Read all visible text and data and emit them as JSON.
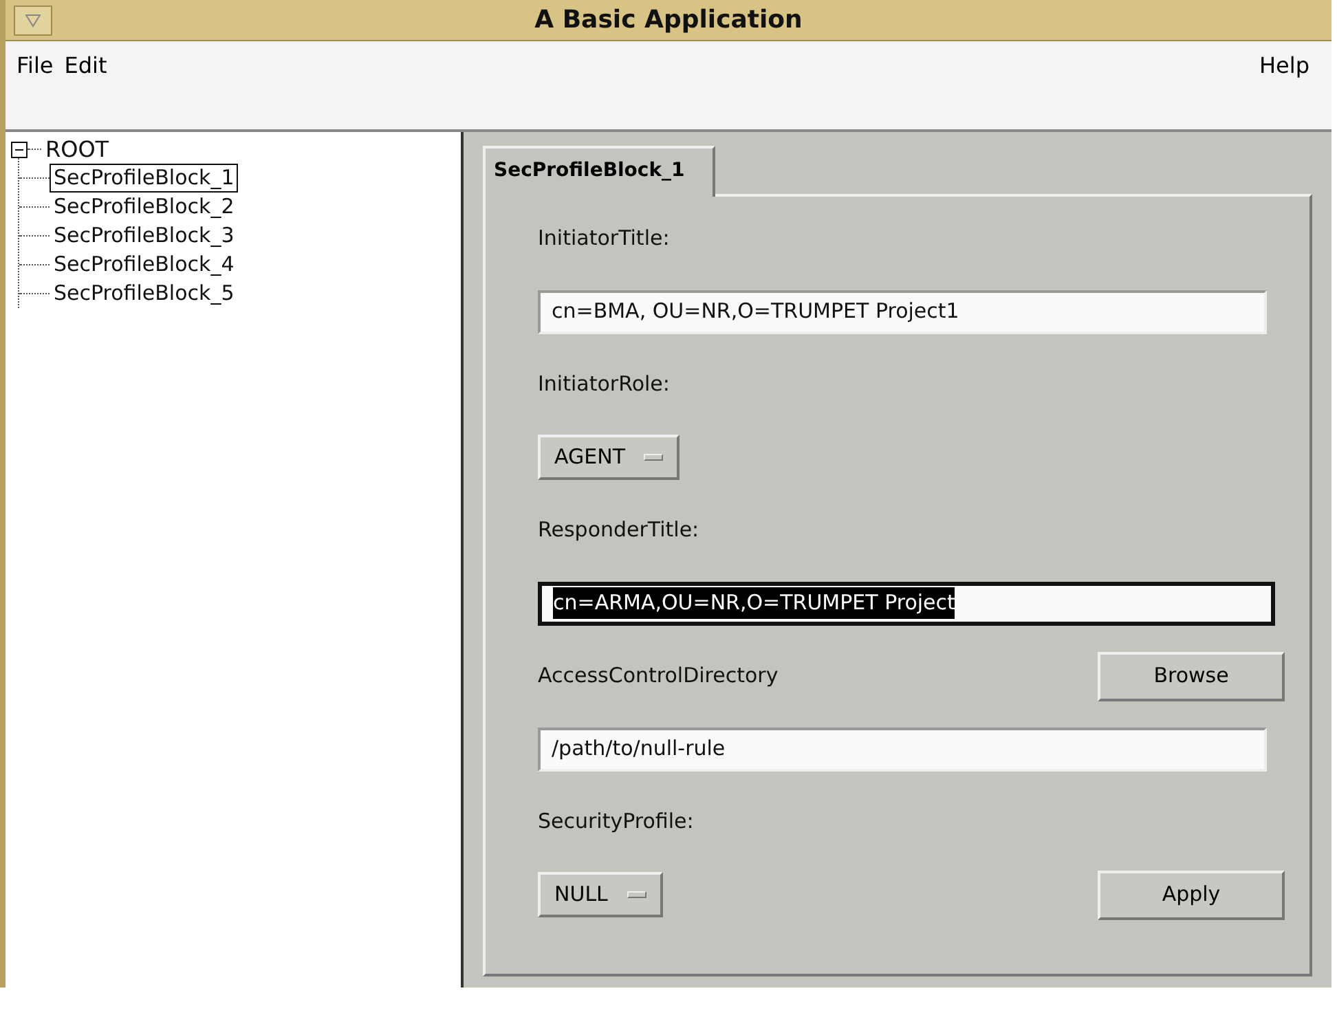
{
  "window": {
    "title": "A Basic Application"
  },
  "menu": {
    "left": [
      "File",
      "Edit"
    ],
    "right": [
      "Help"
    ]
  },
  "tree": {
    "label": "ROOT",
    "expanded": true,
    "selected": false,
    "children": [
      {
        "label": "SecProfileBlock_1",
        "selected": true
      },
      {
        "label": "SecProfileBlock_2",
        "selected": false
      },
      {
        "label": "SecProfileBlock_3",
        "selected": false
      },
      {
        "label": "SecProfileBlock_4",
        "selected": false
      },
      {
        "label": "SecProfileBlock_5",
        "selected": false
      }
    ]
  },
  "tabs": [
    {
      "label": "SecProfileBlock_1",
      "selected": true
    }
  ],
  "form": [
    {
      "kind": "label",
      "text": "InitiatorTitle:"
    },
    {
      "kind": "field",
      "value": "cn=BMA, OU=NR,O=TRUMPET Project1",
      "focused": false,
      "highlighted": false
    },
    {
      "kind": "label",
      "text": "InitiatorRole:"
    },
    {
      "kind": "option",
      "value": "AGENT"
    },
    {
      "kind": "label",
      "text": "ResponderTitle:"
    },
    {
      "kind": "field",
      "value": "cn=ARMA,OU=NR,O=TRUMPET Project",
      "focused": true,
      "highlighted": true
    },
    {
      "kind": "label",
      "text": "AccessControlDirectory",
      "button": "Browse"
    },
    {
      "kind": "field",
      "value": "/path/to/null-rule",
      "focused": false,
      "highlighted": false
    },
    {
      "kind": "label",
      "text": "SecurityProfile:"
    },
    {
      "kind": "option",
      "value": "NULL",
      "button": "Apply"
    }
  ]
}
